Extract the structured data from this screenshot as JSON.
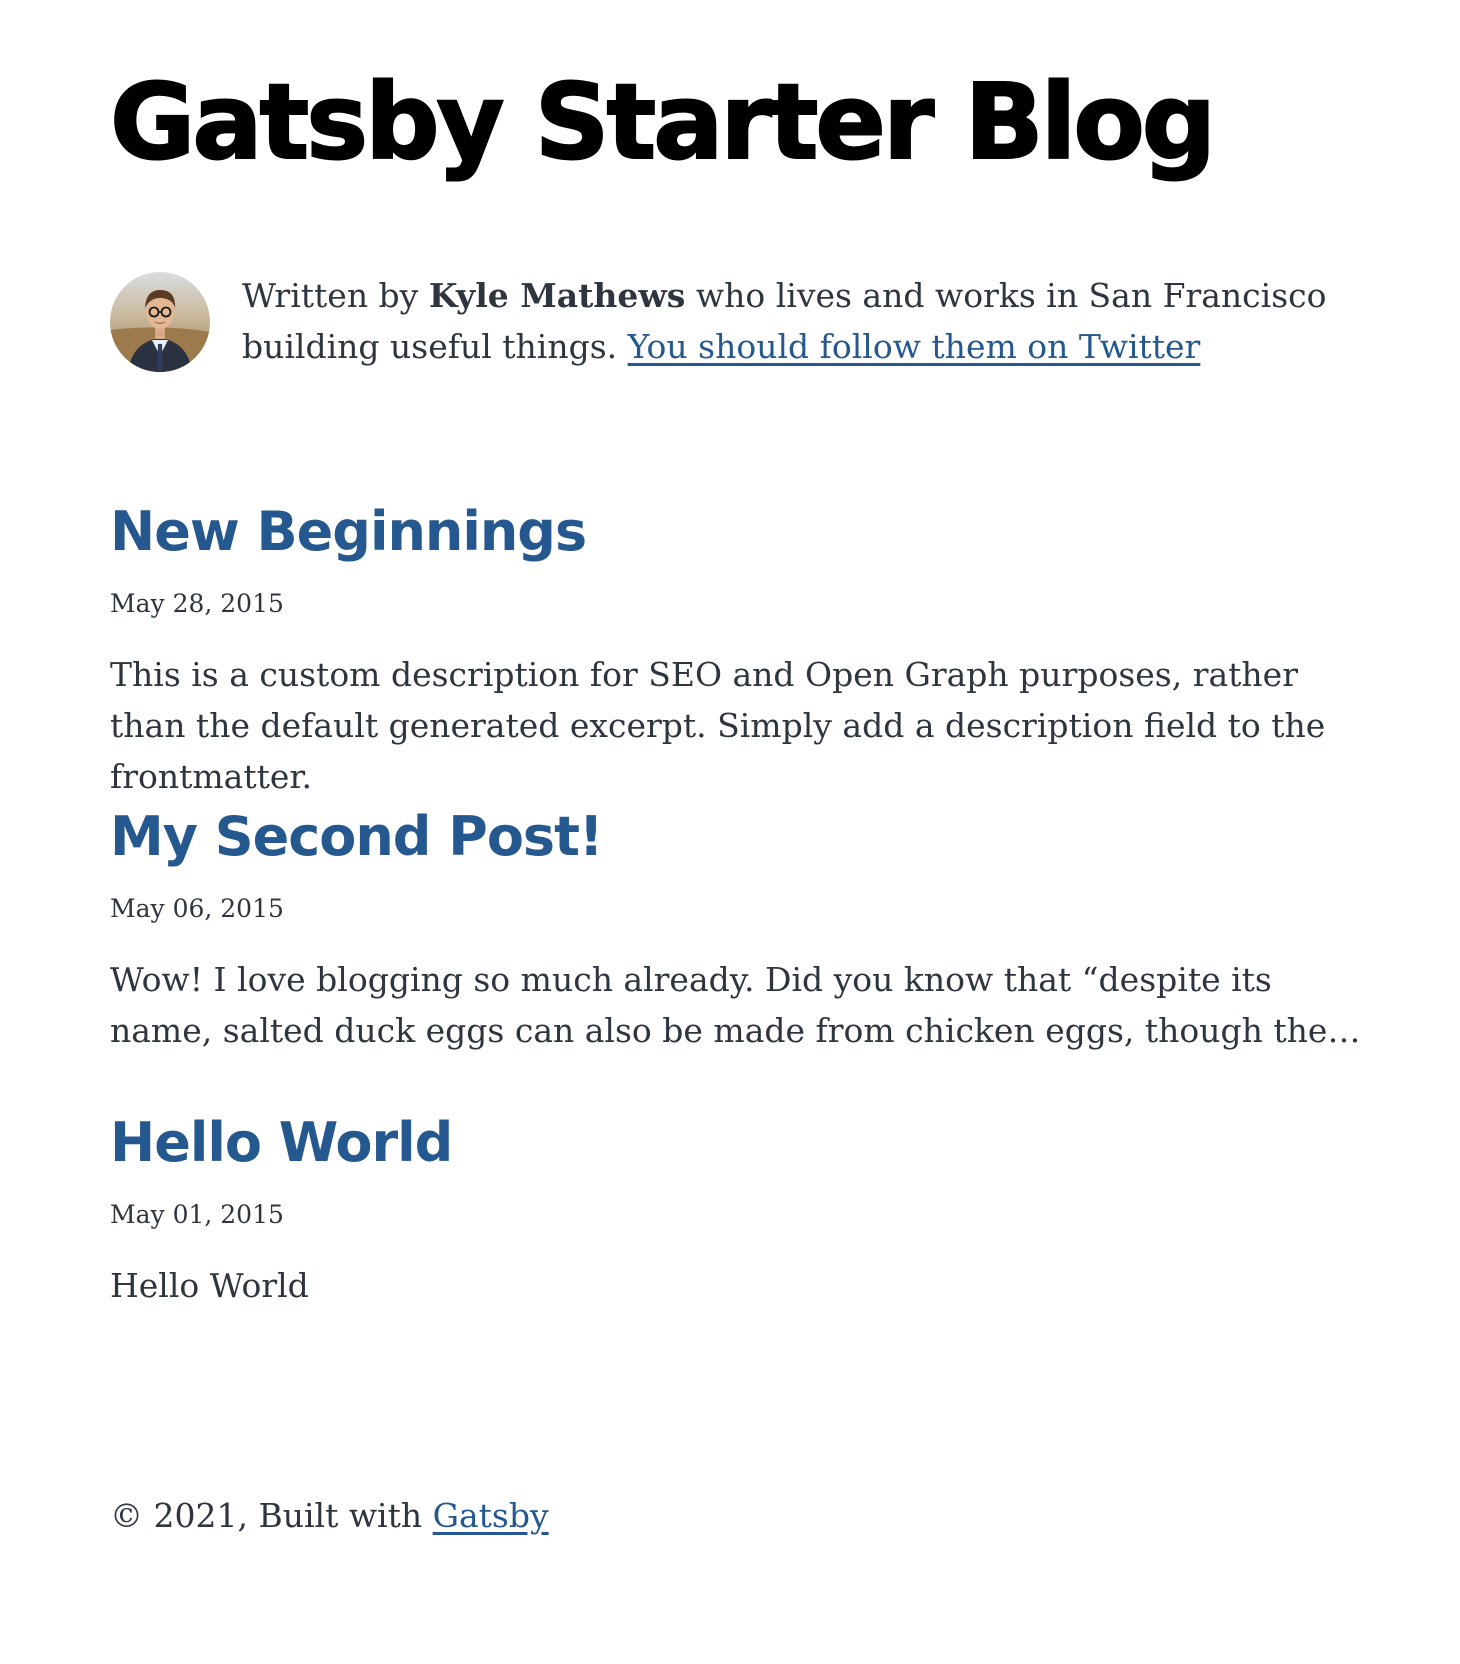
{
  "site": {
    "title": "Gatsby Starter Blog"
  },
  "bio": {
    "prefix": "Written by ",
    "author": "Kyle Mathews",
    "suffix": " who lives and works in San Francisco building useful things. ",
    "link_text": "You should follow them on Twitter",
    "avatar_icon": "author-avatar"
  },
  "posts": [
    {
      "title": "New Beginnings",
      "date": "May 28, 2015",
      "description": "This is a custom description for SEO and Open Graph purposes, rather than the default generated excerpt. Simply add a description field to the frontmatter."
    },
    {
      "title": "My Second Post!",
      "date": "May 06, 2015",
      "description": "Wow! I love blogging so much already. Did you know that “despite its name, salted duck eggs can also be made from chicken eggs, though the…"
    },
    {
      "title": "Hello World",
      "date": "May 01, 2015",
      "description": "Hello World"
    }
  ],
  "footer": {
    "prefix": "© 2021, Built with ",
    "link_text": "Gatsby"
  },
  "colors": {
    "link": "#25588f",
    "text": "#2e353f",
    "heading": "#000000"
  }
}
